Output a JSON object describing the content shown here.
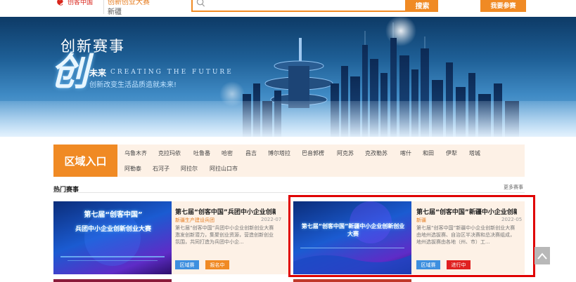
{
  "header": {
    "logo_text": "创客中国",
    "brand_sub": "创新创业大赛",
    "brand_region": "新疆",
    "search_button": "搜索",
    "join_button": "我要参赛"
  },
  "banner": {
    "title": "创新赛事",
    "chuang": "创",
    "weilai": "未来",
    "english": "CREATING THE FUTURE",
    "slogan": "创新改变生活品质造就未来!"
  },
  "region": {
    "badge": "区域入口",
    "row1": [
      "乌鲁木齐",
      "克拉玛依",
      "吐鲁番",
      "哈密",
      "昌吉",
      "博尔塔拉",
      "巴音郭楞",
      "阿克苏",
      "克孜勒苏",
      "喀什",
      "和田",
      "伊犁",
      "塔城"
    ],
    "row2": [
      "阿勒泰",
      "石河子",
      "阿拉尔",
      "阿拉山口市"
    ]
  },
  "hot": {
    "title": "热门赛事",
    "more": "更多赛事",
    "cards": [
      {
        "name": "第七届“创客中国”兵团中小企业创新创",
        "org": "新疆生产建设兵团",
        "date": "2022-07",
        "desc": "第七届“创客中国”兵团中小企业创新创业大赛激发创新潜力，集聚创业资源，营造创新创业氛围，共同打造为兵团中小企...",
        "region_tag": "区域赛",
        "status_tag": "报名中",
        "status_color": "#f08a24",
        "image_line1": "第七届“创客中国”",
        "image_line2": "兵团中小企业创新创业大赛"
      },
      {
        "name": "第七届“创客中国”新疆中小企业创新创",
        "org": "新疆",
        "date": "2022-05",
        "desc": "第七届“创客中国”新疆中小企业创新创业大赛由地州选拔赛、自治区半决赛和总决赛组成，地州选拔赛由各地（州、市）工...",
        "region_tag": "区域赛",
        "status_tag": "进行中",
        "status_color": "#e02020",
        "image_line1": "第七届“创客中国”新疆中小企业创新创业大赛",
        "image_line2": ""
      }
    ]
  },
  "colors": {
    "accent": "#f08a24",
    "highlight": "#e00000",
    "tag_blue": "#3d8fdf"
  }
}
